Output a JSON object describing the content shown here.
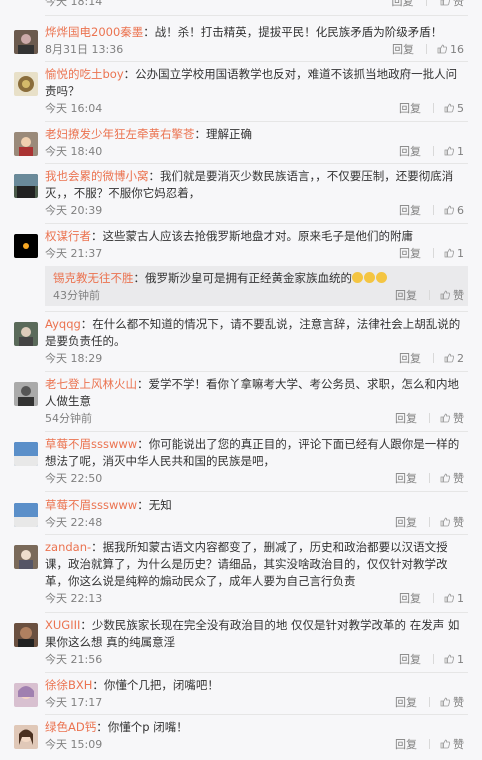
{
  "top_partial": {
    "time": "今天 18:14"
  },
  "like_label": "赞",
  "reply_label": "回复",
  "comments": [
    {
      "user": "烨烨国电2000秦墨",
      "text": "：战！杀！打击精英，提拔平民！化民族矛盾为阶级矛盾！",
      "time": "8月31日 13:36",
      "likes": "16"
    },
    {
      "user": "愉悦的吃土boy",
      "text": "：公办国立学校用国语教学也反对，难道不该抓当地政府一批人问责吗？",
      "time": "今天 16:04",
      "likes": "5"
    },
    {
      "user": "老妇撩发少年狂左牵黄右擎苍",
      "text": "：理解正确",
      "time": "今天 18:40",
      "likes": "1"
    },
    {
      "user": "我也会累的微博小窝",
      "text": "：我们就是要消灭少数民族语言，，不仅要压制，还要彻底消灭，，不服？不服你它妈忍着，",
      "time": "今天 20:39",
      "likes": "6"
    },
    {
      "user": "权谋行者",
      "text": "：这些蒙古人应该去抢俄罗斯地盘才对。原来毛子是他们的附庸",
      "time": "今天 21:37",
      "likes": "1"
    },
    {
      "user": "Ayqqg",
      "text": "：在什么都不知道的情况下，请不要乱说，注意言辞，法律社会上胡乱说的是要负责任的。",
      "time": "今天 18:29",
      "likes": "2"
    },
    {
      "user": "老七登上风林火山",
      "text": "：爱学不学！看你丫拿嘛考大学、考公务员、求职，怎么和内地人做生意",
      "time": "54分钟前",
      "likes": "赞"
    },
    {
      "user": "草莓不眉ssswww",
      "text": "：你可能说出了您的真正目的，评论下面已经有人跟你是一样的想法了呢，消灭中华人民共和国的民族是吧，",
      "time": "今天 22:50",
      "likes": "赞"
    },
    {
      "user": "草莓不眉ssswww",
      "text": "：无知",
      "time": "今天 22:48",
      "likes": "赞"
    },
    {
      "user": "zandan-",
      "text": "：据我所知蒙古语文内容都变了，删减了，历史和政治都要以汉语文授课，政治就算了，为什么是历史？请细品，其实没啥政治目的，仅仅针对教学改革，你这么说是纯粹的煽动民众了，成年人要为自己言行负责",
      "time": "今天 22:13",
      "likes": "1"
    },
    {
      "user": "XUGIII",
      "text": "：少数民族家长现在完全没有政治目的地 仅仅是针对教学改革的 在发声 如果你这么想 真的纯属意淫",
      "time": "今天 21:56",
      "likes": "1"
    },
    {
      "user": "徐徐BXH",
      "text": "：你懂个几把，闭嘴吧！",
      "time": "今天 17:17",
      "likes": "赞"
    },
    {
      "user": "绿色AD钙",
      "text": "：你懂个p 闭嘴！",
      "time": "今天 15:09",
      "likes": "赞"
    }
  ],
  "subreply": {
    "user": "锡克教无往不胜",
    "text": "：俄罗斯沙皇可是拥有正经黄金家族血统的",
    "time": "43分钟前",
    "likes": "赞"
  },
  "colors": {
    "username": "#eb7350",
    "background": "#f7f7f9",
    "meta": "#808080"
  }
}
